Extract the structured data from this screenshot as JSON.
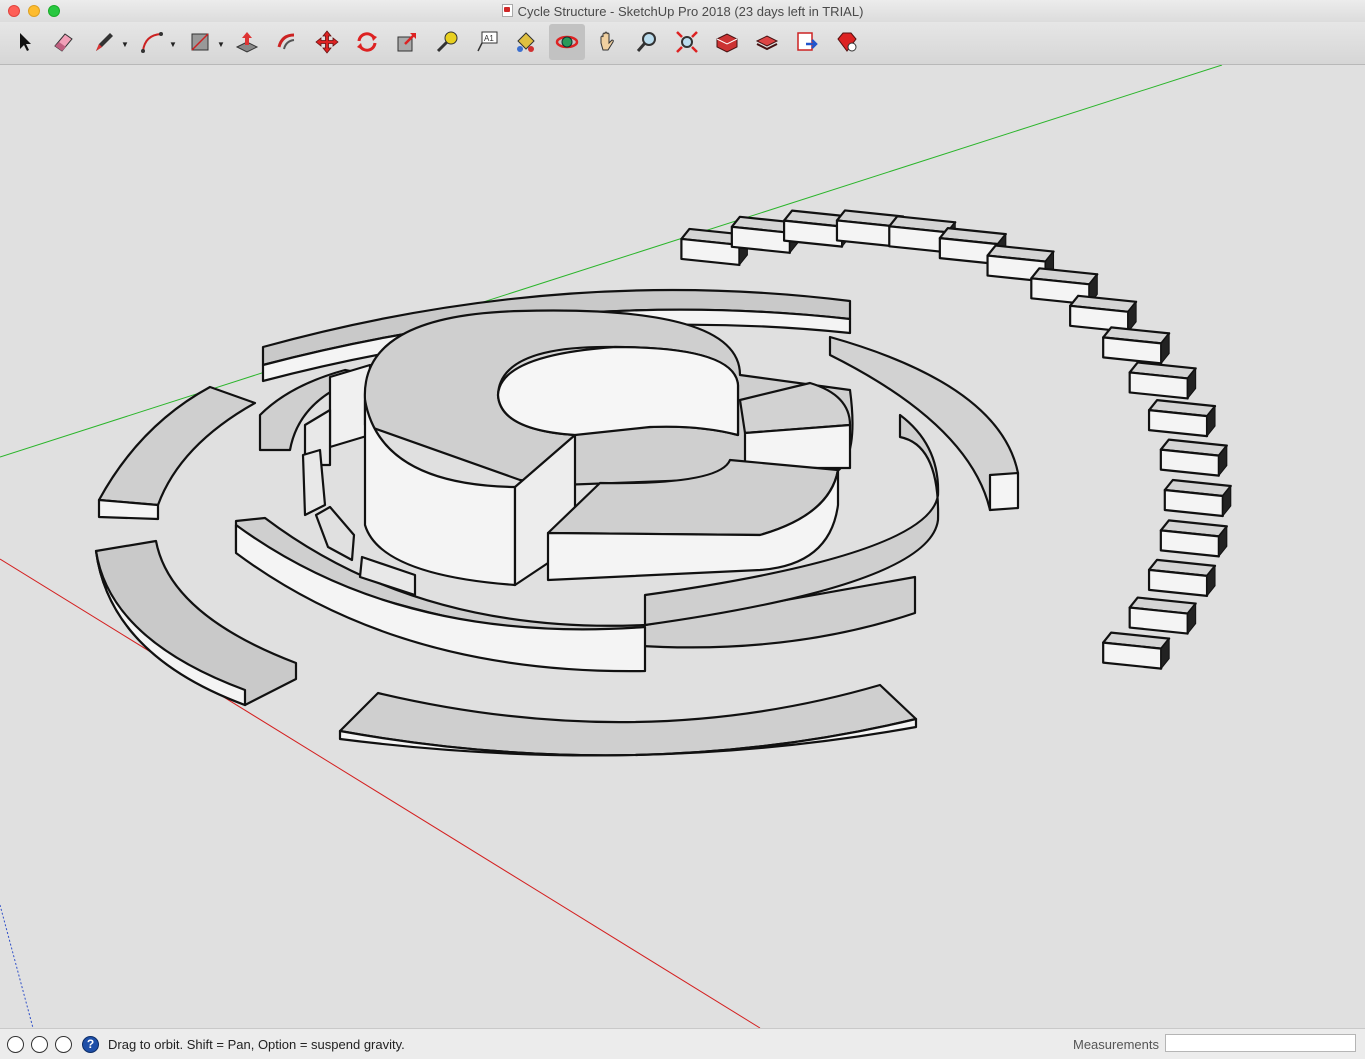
{
  "window": {
    "title": "Cycle Structure - SketchUp Pro 2018 (23 days left in TRIAL)"
  },
  "toolbar": {
    "tools": [
      {
        "name": "select-tool",
        "icon": "arrow-cursor-icon"
      },
      {
        "name": "eraser-tool",
        "icon": "eraser-icon"
      },
      {
        "name": "line-tool",
        "icon": "pencil-icon",
        "has_dropdown": true
      },
      {
        "name": "arc-tool",
        "icon": "arc-icon",
        "has_dropdown": true
      },
      {
        "name": "rectangle-tool",
        "icon": "rectangle-icon",
        "has_dropdown": true
      },
      {
        "name": "push-pull-tool",
        "icon": "push-pull-icon"
      },
      {
        "name": "offset-tool",
        "icon": "offset-icon"
      },
      {
        "name": "move-tool",
        "icon": "move-icon"
      },
      {
        "name": "rotate-tool",
        "icon": "rotate-icon"
      },
      {
        "name": "scale-tool",
        "icon": "scale-icon"
      },
      {
        "name": "tape-measure-tool",
        "icon": "tape-measure-icon"
      },
      {
        "name": "text-tool",
        "icon": "text-icon",
        "label": "A1"
      },
      {
        "name": "paint-bucket-tool",
        "icon": "paint-bucket-icon"
      },
      {
        "name": "orbit-tool",
        "icon": "orbit-icon",
        "active": true
      },
      {
        "name": "pan-tool",
        "icon": "hand-icon"
      },
      {
        "name": "zoom-tool",
        "icon": "magnifier-icon"
      },
      {
        "name": "zoom-extents-tool",
        "icon": "zoom-extents-icon"
      },
      {
        "name": "warehouse-tool",
        "icon": "3d-warehouse-icon"
      },
      {
        "name": "extension-warehouse-tool",
        "icon": "extension-warehouse-icon"
      },
      {
        "name": "send-to-layout-tool",
        "icon": "layout-icon"
      },
      {
        "name": "extension-manager-tool",
        "icon": "ruby-gem-icon"
      }
    ]
  },
  "viewport": {
    "axes_colors": {
      "green": "#2bb52b",
      "red": "#d42020",
      "blue": "#3050c8"
    },
    "background": "#e0e0e0"
  },
  "statusbar": {
    "hint": "Drag to orbit. Shift = Pan, Option = suspend gravity.",
    "measurements_label": "Measurements",
    "measurements_value": ""
  }
}
